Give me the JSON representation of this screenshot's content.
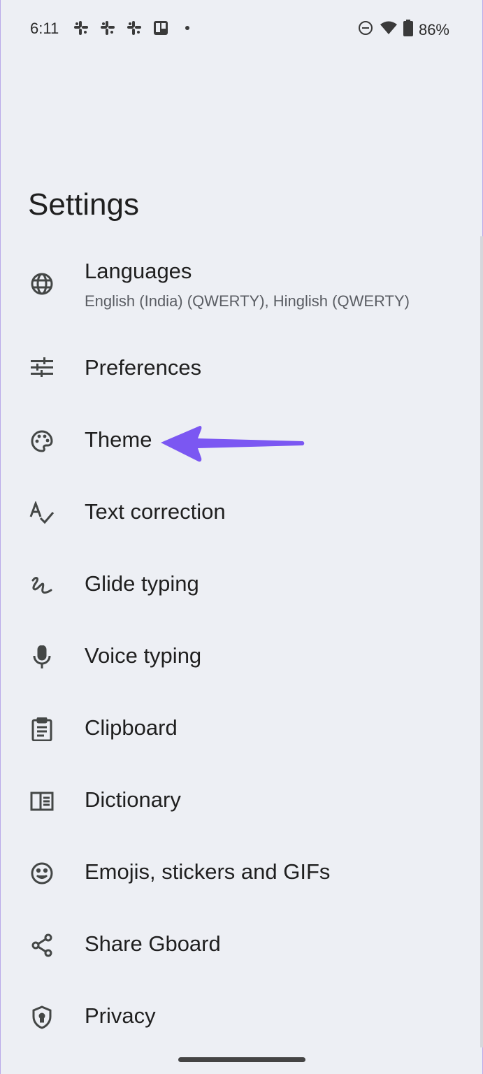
{
  "status_bar": {
    "time": "6:11",
    "notification_icons": [
      "slack-icon",
      "slack-icon",
      "slack-icon",
      "trello-icon",
      "dot-icon"
    ],
    "system_icons": [
      "do-not-disturb-icon",
      "wifi-icon",
      "battery-icon"
    ],
    "battery_percent": "86%"
  },
  "page": {
    "title": "Settings"
  },
  "settings_items": [
    {
      "label": "Languages",
      "subtitle": "English (India) (QWERTY), Hinglish (QWERTY)",
      "icon": "globe-icon"
    },
    {
      "label": "Preferences",
      "icon": "sliders-icon"
    },
    {
      "label": "Theme",
      "icon": "palette-icon"
    },
    {
      "label": "Text correction",
      "icon": "spellcheck-icon"
    },
    {
      "label": "Glide typing",
      "icon": "gesture-icon"
    },
    {
      "label": "Voice typing",
      "icon": "mic-icon"
    },
    {
      "label": "Clipboard",
      "icon": "clipboard-icon"
    },
    {
      "label": "Dictionary",
      "icon": "book-icon"
    },
    {
      "label": "Emojis, stickers and GIFs",
      "icon": "emoji-icon"
    },
    {
      "label": "Share Gboard",
      "icon": "share-icon"
    },
    {
      "label": "Privacy",
      "icon": "shield-icon"
    }
  ],
  "annotation": {
    "arrow_color": "#7b57f2",
    "points_to": "Theme"
  },
  "colors": {
    "background": "#edeff4",
    "text": "#1f1f1f",
    "icon": "#444746",
    "accent_arrow": "#7b57f2"
  }
}
